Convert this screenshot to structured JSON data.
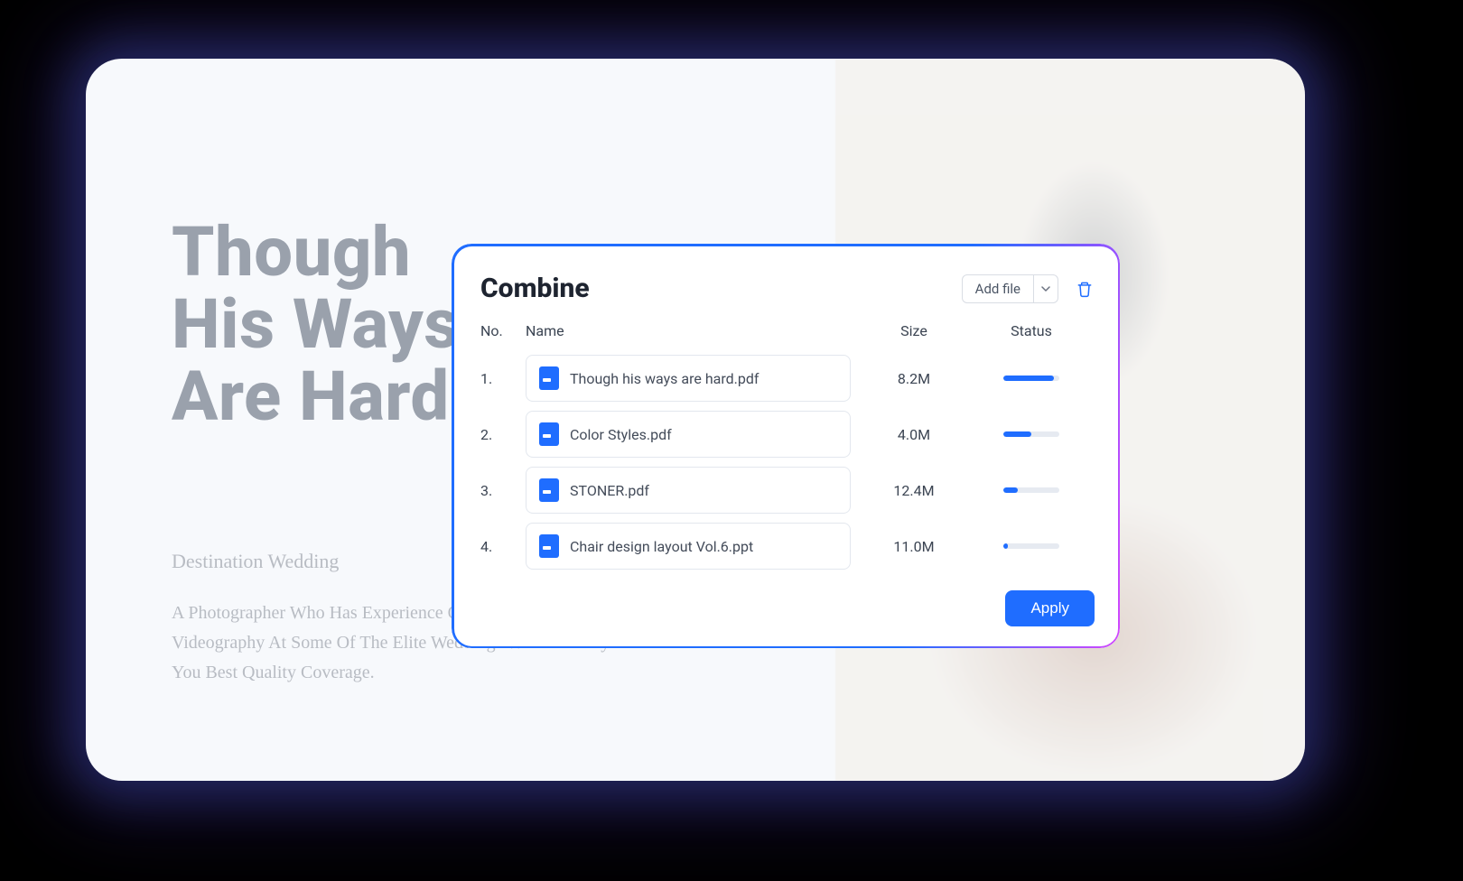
{
  "hero": {
    "title_line1": "Though",
    "title_line2": "His Ways",
    "title_line3": "Are Hard",
    "subtitle": "Destination Wedding",
    "paragraph": "A Photographer Who Has Experience Of Photography & Videography At Some Of The Elite Weddings Will Certainly Offer You Best Quality Coverage."
  },
  "modal": {
    "title": "Combine",
    "add_file_label": "Add file",
    "apply_label": "Apply",
    "columns": {
      "no": "No.",
      "name": "Name",
      "size": "Size",
      "status": "Status"
    },
    "rows": [
      {
        "no": "1.",
        "name": "Though his ways are hard.pdf",
        "size": "8.2M",
        "progress_pct": 90
      },
      {
        "no": "2.",
        "name": "Color Styles.pdf",
        "size": "4.0M",
        "progress_pct": 50
      },
      {
        "no": "3.",
        "name": "STONER.pdf",
        "size": "12.4M",
        "progress_pct": 25
      },
      {
        "no": "4.",
        "name": "Chair design layout Vol.6.ppt",
        "size": "11.0M",
        "progress_pct": 8
      }
    ]
  }
}
